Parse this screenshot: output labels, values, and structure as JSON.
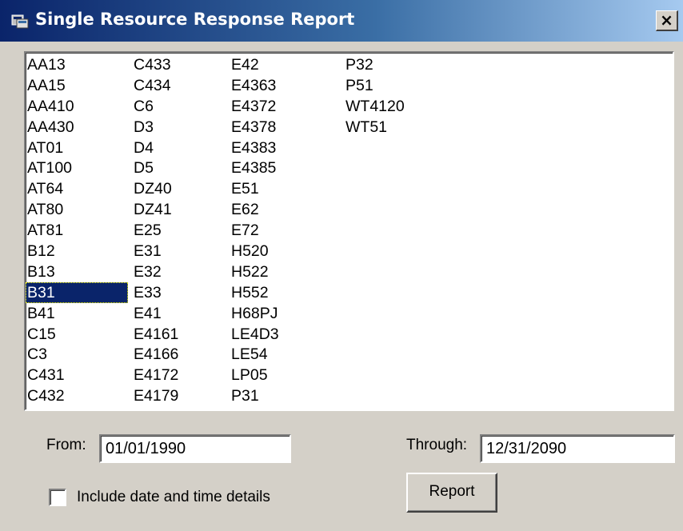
{
  "window": {
    "title": "Single Resource Response Report",
    "close_label": "×"
  },
  "resources": {
    "selected": "B31",
    "columns": [
      [
        "AA13",
        "AA15",
        "AA410",
        "AA430",
        "AT01",
        "AT100",
        "AT64",
        "AT80",
        "AT81",
        "B12",
        "B13",
        "B31",
        "B41",
        "C15",
        "C3",
        "C431",
        "C432"
      ],
      [
        "C433",
        "C434",
        "C6",
        "D3",
        "D4",
        "D5",
        "DZ40",
        "DZ41",
        "E25",
        "E31",
        "E32",
        "E33",
        "E41",
        "E4161",
        "E4166",
        "E4172",
        "E4179"
      ],
      [
        "E42",
        "E4363",
        "E4372",
        "E4378",
        "E4383",
        "E4385",
        "E51",
        "E62",
        "E72",
        "H520",
        "H522",
        "H552",
        "H68PJ",
        "LE4D3",
        "LE54",
        "LP05",
        "P31"
      ],
      [
        "P32",
        "P51",
        "WT4120",
        "WT51"
      ]
    ]
  },
  "form": {
    "from_label": "From:",
    "from_value": "01/01/1990",
    "through_label": "Through:",
    "through_value": "12/31/2090",
    "include_details_label": "Include date and time details",
    "include_details_checked": false,
    "report_button": "Report"
  },
  "colors": {
    "selection": "#0a246a",
    "dialog_bg": "#d4d0c8"
  }
}
